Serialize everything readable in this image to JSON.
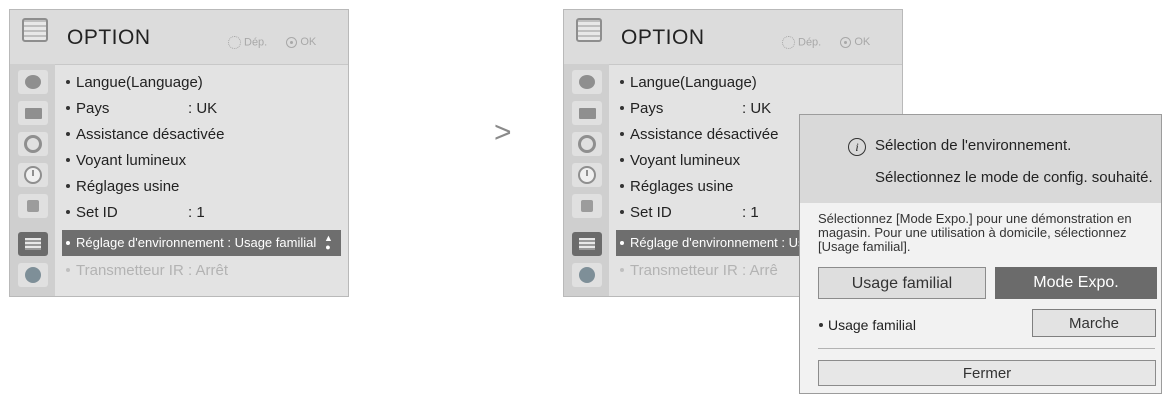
{
  "menu": {
    "title": "OPTION",
    "nav_move": "Dép.",
    "nav_ok": "OK",
    "items": [
      {
        "label": "Langue(Language)",
        "value": ""
      },
      {
        "label": "Pays",
        "value": ": UK"
      },
      {
        "label": "Assistance désactivée",
        "value": ""
      },
      {
        "label": "Voyant lumineux",
        "value": ""
      },
      {
        "label": "Réglages usine",
        "value": ""
      },
      {
        "label": "Set ID",
        "value": ": 1"
      },
      {
        "label": "Réglage d'environnement : Usage familial",
        "value": ""
      },
      {
        "label": "Transmetteur IR",
        "value": ": Arrêt"
      }
    ],
    "right_selected_truncated": "Réglage d'environnement : Usag",
    "right_ir_value": ": Arrê"
  },
  "arrow_glyph": ">",
  "popup": {
    "info_glyph": "i",
    "line1": "Sélection de l'environnement.",
    "line2": "Sélectionnez le mode de config. souhaité.",
    "description": "Sélectionnez [Mode Expo.] pour une démonstration en magasin. Pour une utilisation à domicile, sélectionnez [Usage familial].",
    "button_usage": "Usage familial",
    "button_expo": "Mode Expo.",
    "setting_label": "Usage familial",
    "setting_value": "Marche",
    "close_label": "Fermer"
  }
}
